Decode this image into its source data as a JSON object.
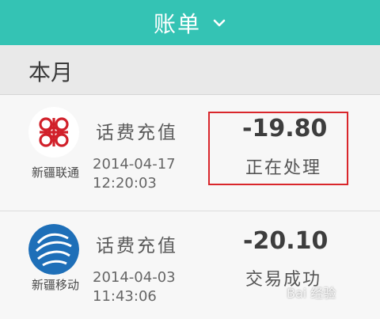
{
  "header": {
    "title": "账单",
    "dropdown_icon": "chevron-down-icon"
  },
  "section": {
    "label": "本月"
  },
  "transactions": [
    {
      "carrier": "新疆联通",
      "logo_icon": "china-unicom-logo",
      "description": "话费充值",
      "date": "2014-04-17",
      "time": "12:20:03",
      "amount": "-19.80",
      "status": "正在处理"
    },
    {
      "carrier": "新疆移动",
      "logo_icon": "china-mobile-logo",
      "description": "话费充值",
      "date": "2014-04-03",
      "time": "11:43:06",
      "amount": "-20.10",
      "status": "交易成功"
    }
  ],
  "watermark": "Bai 经验",
  "colors": {
    "header_bg": "#34c3b4",
    "highlight_border": "#d9262b"
  }
}
